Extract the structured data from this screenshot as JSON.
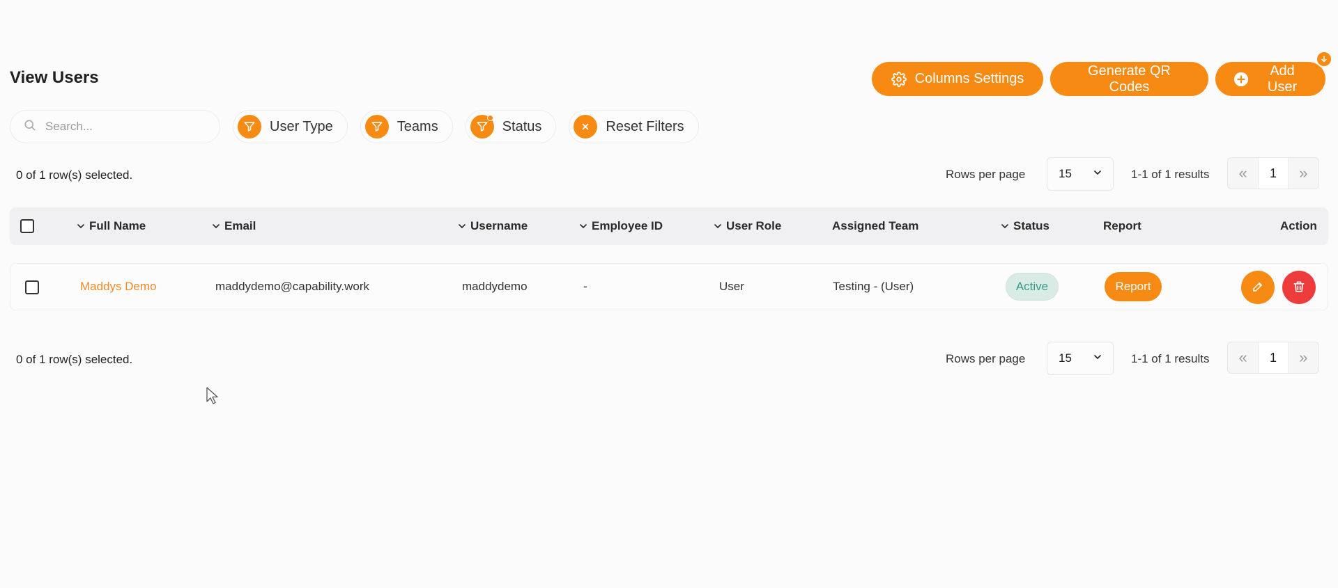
{
  "page": {
    "title": "View Users"
  },
  "toolbar": {
    "columns_settings": "Columns Settings",
    "generate_qr": "Generate QR Codes",
    "add_user": "Add User"
  },
  "filters": {
    "search_placeholder": "Search...",
    "user_type": "User Type",
    "teams": "Teams",
    "status": "Status",
    "reset": "Reset Filters"
  },
  "pagination": {
    "selected_text": "0 of 1 row(s) selected.",
    "rows_per_page_label": "Rows per page",
    "rows_per_page_value": "15",
    "results_text": "1-1 of 1 results",
    "current_page": "1"
  },
  "table": {
    "columns": {
      "full_name": "Full Name",
      "email": "Email",
      "username": "Username",
      "employee_id": "Employee ID",
      "user_role": "User Role",
      "assigned_team": "Assigned Team",
      "status": "Status",
      "report": "Report",
      "action": "Action"
    },
    "rows": [
      {
        "full_name": "Maddys Demo",
        "email": "maddydemo@capability.work",
        "username": "maddydemo",
        "employee_id": "-",
        "user_role": "User",
        "assigned_team": "Testing - (User)",
        "status": "Active",
        "report": "Report"
      }
    ]
  },
  "colors": {
    "accent": "#f68a13",
    "danger": "#ee3b3b",
    "active_bg": "#d9ebe5",
    "active_text": "#3a9a83",
    "name_link": "#f0892b"
  }
}
